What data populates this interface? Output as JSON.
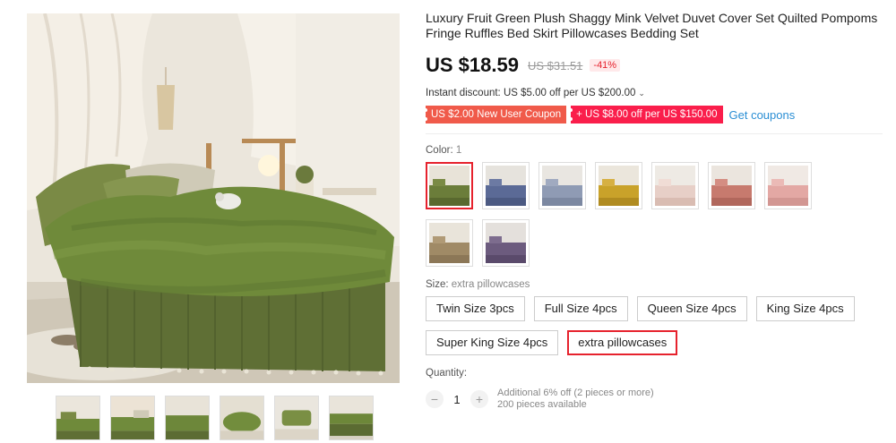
{
  "product": {
    "title": "Luxury Fruit Green Plush Shaggy Mink Velvet Duvet Cover Set Quilted Pompoms Fringe Ruffles Bed Skirt Pillowcases Bedding Set",
    "price": "US $18.59",
    "old_price": "US $31.51",
    "discount": "-41%",
    "instant_discount": "Instant discount: US $5.00 off per US $200.00",
    "instant_chevron": "⌄"
  },
  "coupons": {
    "items": [
      {
        "label": "US $2.00 New User Coupon",
        "color": "#f05a4a"
      },
      {
        "label": "+ US $8.00 off per US $150.00",
        "color": "#fa1e4b"
      }
    ],
    "get_label": "Get coupons"
  },
  "color": {
    "label": "Color:",
    "value": "1",
    "swatches": [
      {
        "name": "green",
        "hex": "#6b7d3a"
      },
      {
        "name": "blue",
        "hex": "#5b6a96"
      },
      {
        "name": "light-blue",
        "hex": "#8f9bb4"
      },
      {
        "name": "yellow",
        "hex": "#c9a22a"
      },
      {
        "name": "light-pink",
        "hex": "#e7cfc7"
      },
      {
        "name": "salmon",
        "hex": "#c77a6e"
      },
      {
        "name": "pink",
        "hex": "#e3a8a4"
      },
      {
        "name": "khaki",
        "hex": "#a08a66"
      },
      {
        "name": "purple",
        "hex": "#6c5b7e"
      }
    ]
  },
  "size": {
    "label": "Size:",
    "value": "extra pillowcases",
    "options": [
      "Twin Size 3pcs",
      "Full Size 4pcs",
      "Queen Size 4pcs",
      "King Size 4pcs",
      "Super King Size 4pcs",
      "extra pillowcases"
    ]
  },
  "quantity": {
    "label": "Quantity:",
    "value": "1",
    "minus": "−",
    "plus": "+",
    "note1": "Additional 6% off (2 pieces or more)",
    "note2": "200 pieces available"
  },
  "theme": {
    "accent": "#e6222d",
    "link": "#2a8ed4",
    "bed_green": "#6f8a3a"
  }
}
